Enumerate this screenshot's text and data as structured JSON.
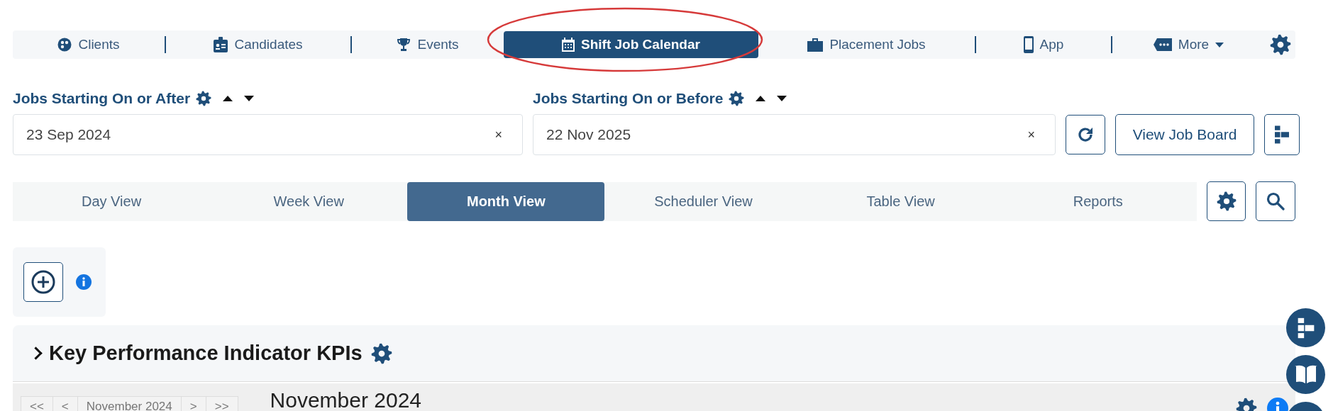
{
  "nav": {
    "items": [
      {
        "label": "Clients",
        "selected": false
      },
      {
        "label": "Candidates",
        "selected": false
      },
      {
        "label": "Events",
        "selected": false
      },
      {
        "label": "Shift Job Calendar",
        "selected": true
      },
      {
        "label": "Placement Jobs",
        "selected": false
      },
      {
        "label": "App",
        "selected": false
      },
      {
        "label": "More",
        "selected": false
      }
    ]
  },
  "filters": [
    {
      "label": "Jobs Starting On or After",
      "value": "23 Sep 2024",
      "clear": "×"
    },
    {
      "label": "Jobs Starting On or Before",
      "value": "22 Nov 2025",
      "clear": "×"
    }
  ],
  "view_job_board": "View Job Board",
  "views": [
    {
      "label": "Day View",
      "selected": false
    },
    {
      "label": "Week View",
      "selected": false
    },
    {
      "label": "Month View",
      "selected": true
    },
    {
      "label": "Scheduler View",
      "selected": false
    },
    {
      "label": "Table View",
      "selected": false
    },
    {
      "label": "Reports",
      "selected": false
    }
  ],
  "kpi": {
    "title": "Key Performance Indicator KPIs",
    "expanded": false
  },
  "calendar": {
    "nav": [
      "<<",
      "<",
      "November 2024",
      ">",
      ">>"
    ],
    "title": "November 2024"
  }
}
